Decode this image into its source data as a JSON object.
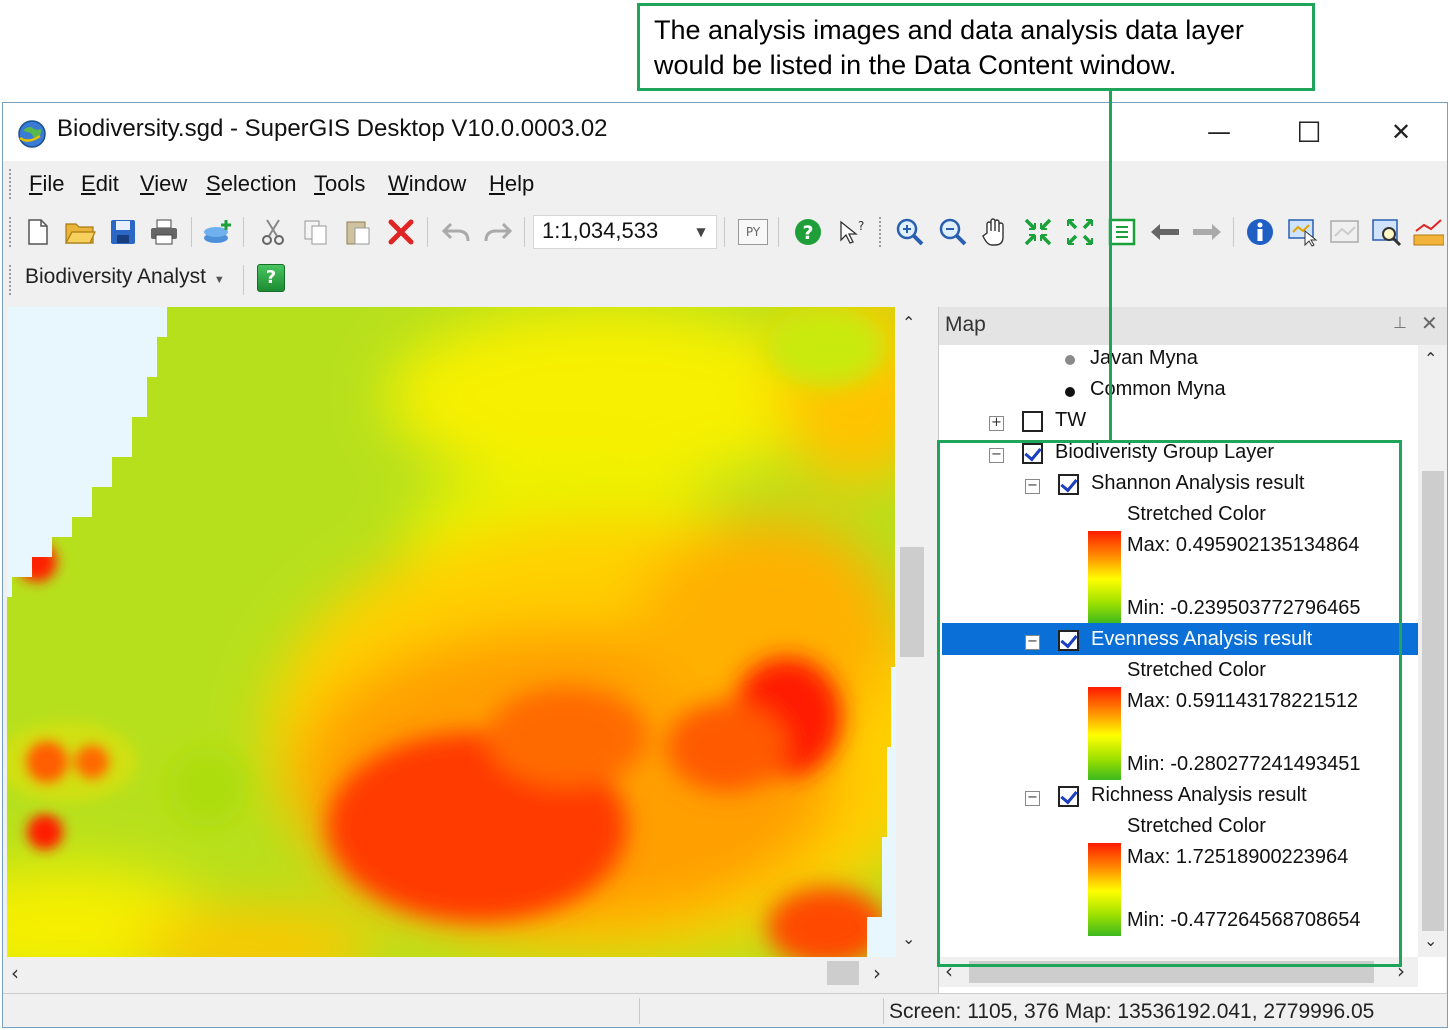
{
  "callout": {
    "text": "The analysis images and data analysis data layer would be listed in the Data Content window."
  },
  "window": {
    "title": "Biodiversity.sgd - SuperGIS Desktop V10.0.0003.02",
    "minimize_glyph": "—",
    "maximize_glyph": "☐",
    "close_glyph": "✕"
  },
  "menu": {
    "file": "ile",
    "edit": "dit",
    "view": "iew",
    "selection": "election",
    "tools": "ools",
    "window": "indow",
    "help": "elp",
    "file_u": "F",
    "edit_u": "E",
    "view_u": "V",
    "selection_u": "S",
    "tools_u": "T",
    "window_u": "W",
    "help_u": "H"
  },
  "toolbar": {
    "scale": "1:1,034,533",
    "python_label": "PY",
    "icons": [
      "new-file-icon",
      "open-folder-icon",
      "save-icon",
      "print-icon",
      "add-data-icon",
      "cut-icon",
      "copy-icon",
      "paste-icon",
      "delete-icon",
      "undo-icon",
      "redo-icon",
      "python-icon",
      "help-icon",
      "whats-this-icon",
      "zoom-in-icon",
      "zoom-out-icon",
      "pan-icon",
      "zoom-full-in-icon",
      "zoom-full-out-icon",
      "full-extent-icon",
      "back-icon",
      "forward-icon",
      "identify-icon",
      "select-features-icon",
      "clear-selection-icon",
      "find-icon",
      "measure-icon"
    ]
  },
  "analyst_toolbar": {
    "label": "Biodiversity Analyst",
    "help_glyph": "?"
  },
  "map_panel": {
    "title": "Map",
    "pin_glyph": "📌",
    "close_glyph": "✕",
    "items": {
      "javan_myna": "Javan Myna",
      "common_myna": "Common Myna",
      "tw": "TW",
      "group": "Biodiveristy Group Layer",
      "shannon": "Shannon Analysis result",
      "evenness": "Evenness Analysis result",
      "richness": "Richness Analysis result",
      "stretched": "Stretched Color",
      "shannon_max": "Max: 0.495902135134864",
      "shannon_min": "Min: -0.239503772796465",
      "evenness_max": "Max: 0.591143178221512",
      "evenness_min": "Min: -0.280277241493451",
      "richness_max": "Max: 1.72518900223964",
      "richness_min": "Min: -0.477264568708654"
    }
  },
  "status": {
    "text": "Screen: 1105, 376  Map: 13536192.041, 2779996.05"
  },
  "colors": {
    "accent_green": "#1fa55a",
    "selection_blue": "#0a6fd6",
    "ramp_max": "#ff1a00",
    "ramp_mid": "#ffff00",
    "ramp_min": "#3cb81f"
  }
}
